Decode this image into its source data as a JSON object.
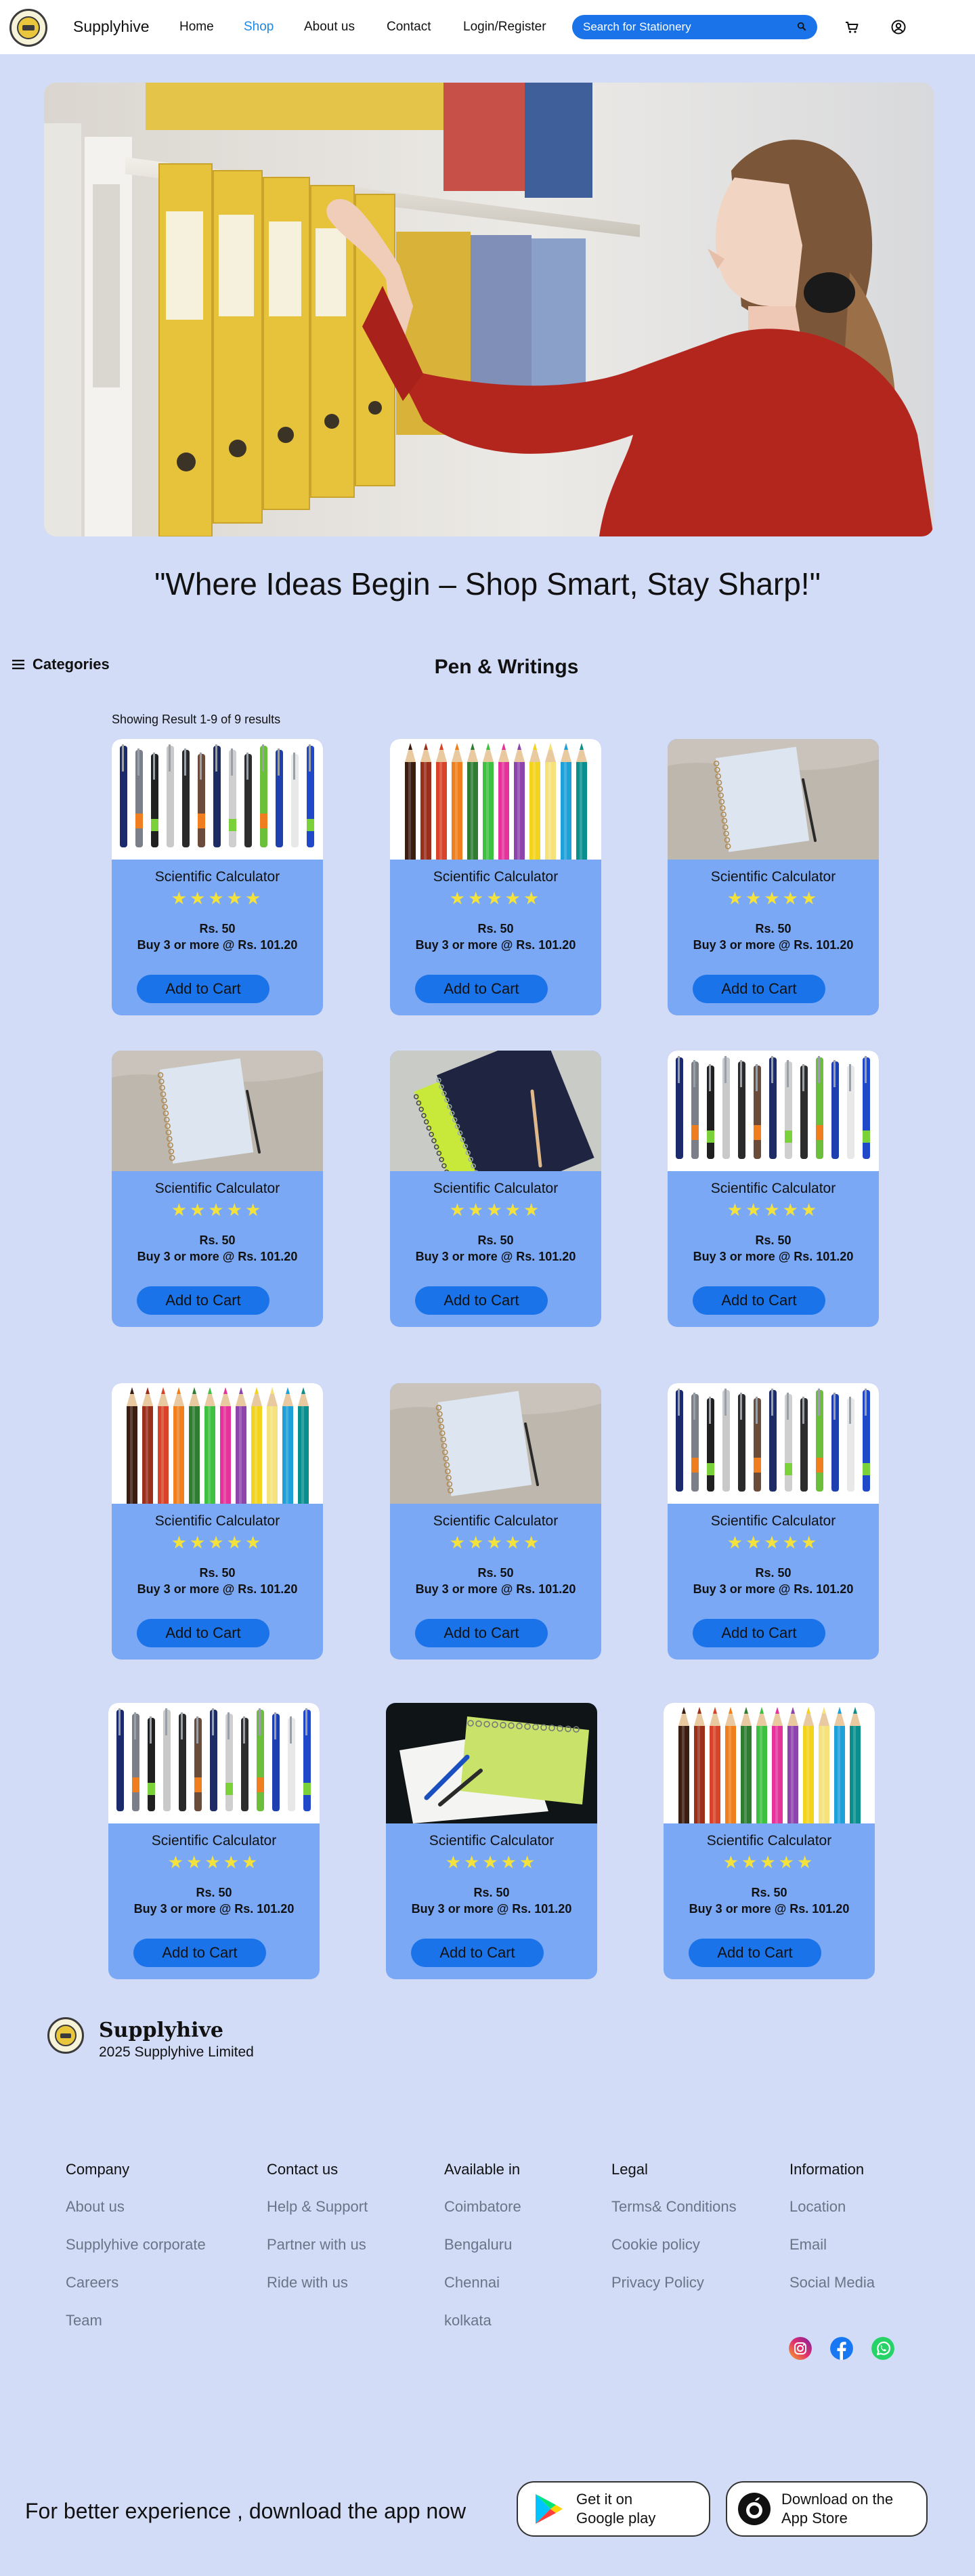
{
  "header": {
    "brand": "Supplyhive",
    "nav": [
      "Home",
      "Shop",
      "About us",
      "Contact",
      "Login/Register"
    ],
    "search_placeholder": "Search for Stationery"
  },
  "hero": {
    "tagline": "\"Where Ideas Begin – Shop Smart, Stay Sharp!\""
  },
  "categories_label": "Categories",
  "section_title": "Pen & Writings",
  "result_count": "Showing Result 1-9 of 9 results",
  "products": [
    {
      "image": "pens",
      "name": "Scientific Calculator",
      "stars": "★★★★★",
      "price": "Rs. 50",
      "bulk": "Buy 3 or more @ Rs. 101.20",
      "button": "Add to Cart"
    },
    {
      "image": "pencils",
      "name": "Scientific Calculator",
      "stars": "★★★★★",
      "price": "Rs. 50",
      "bulk": "Buy 3 or more @ Rs. 101.20",
      "button": "Add to Cart"
    },
    {
      "image": "notepad",
      "name": "Scientific Calculator",
      "stars": "★★★★★",
      "price": "Rs. 50",
      "bulk": "Buy 3 or more @ Rs. 101.20",
      "button": "Add to Cart"
    },
    {
      "image": "notepad",
      "name": "Scientific Calculator",
      "stars": "★★★★★",
      "price": "Rs. 50",
      "bulk": "Buy 3 or more @ Rs. 101.20",
      "button": "Add to Cart"
    },
    {
      "image": "notebooks",
      "name": "Scientific Calculator",
      "stars": "★★★★★",
      "price": "Rs. 50",
      "bulk": "Buy 3 or more @ Rs. 101.20",
      "button": "Add to Cart"
    },
    {
      "image": "pens",
      "name": "Scientific Calculator",
      "stars": "★★★★★",
      "price": "Rs. 50",
      "bulk": "Buy 3 or more @ Rs. 101.20",
      "button": "Add to Cart"
    },
    {
      "image": "pencils",
      "name": "Scientific Calculator",
      "stars": "★★★★★",
      "price": "Rs. 50",
      "bulk": "Buy 3 or more @ Rs. 101.20",
      "button": "Add to Cart"
    },
    {
      "image": "notepad",
      "name": "Scientific Calculator",
      "stars": "★★★★★",
      "price": "Rs. 50",
      "bulk": "Buy 3 or more @ Rs. 101.20",
      "button": "Add to Cart"
    },
    {
      "image": "pens",
      "name": "Scientific Calculator",
      "stars": "★★★★★",
      "price": "Rs. 50",
      "bulk": "Buy 3 or more @ Rs. 101.20",
      "button": "Add to Cart"
    },
    {
      "image": "pens",
      "name": "Scientific Calculator",
      "stars": "★★★★★",
      "price": "Rs. 50",
      "bulk": "Buy 3 or more @ Rs. 101.20",
      "button": "Add to Cart"
    },
    {
      "image": "spiral-notebook",
      "name": "Scientific Calculator",
      "stars": "★★★★★",
      "price": "Rs. 50",
      "bulk": "Buy 3 or more @ Rs. 101.20",
      "button": "Add to Cart"
    },
    {
      "image": "pencils",
      "name": "Scientific Calculator",
      "stars": "★★★★★",
      "price": "Rs. 50",
      "bulk": "Buy 3 or more @ Rs. 101.20",
      "button": "Add to Cart"
    }
  ],
  "footer": {
    "brand": "Supplyhive",
    "copyright": "2025 Supplyhive Limited",
    "columns": [
      {
        "heading": "Company",
        "links": [
          "About us",
          "Supplyhive corporate",
          "Careers",
          "Team"
        ]
      },
      {
        "heading": "Contact us",
        "links": [
          "Help & Support",
          "Partner with us",
          "Ride with us"
        ]
      },
      {
        "heading": "Available in",
        "links": [
          "Coimbatore",
          "Bengaluru",
          "Chennai",
          "kolkata"
        ]
      },
      {
        "heading": "Legal",
        "links": [
          "Terms& Conditions",
          "Cookie policy",
          "Privacy Policy"
        ]
      },
      {
        "heading": "Information",
        "links": [
          "Location",
          "Email",
          "Social Media"
        ]
      }
    ],
    "download_text": "For better experience , download the app now",
    "google_play": {
      "line1": "Get it on",
      "line2": "Google play"
    },
    "app_store": {
      "line1": "Download on the",
      "line2": "App Store"
    }
  },
  "colors": {
    "page_bg": "#d3dcf7",
    "card_bg": "#7aa8f5",
    "accent": "#1a73e8",
    "active_nav": "#1e88e5",
    "stars": "#f4e23c",
    "footer_link": "#6a7487"
  }
}
